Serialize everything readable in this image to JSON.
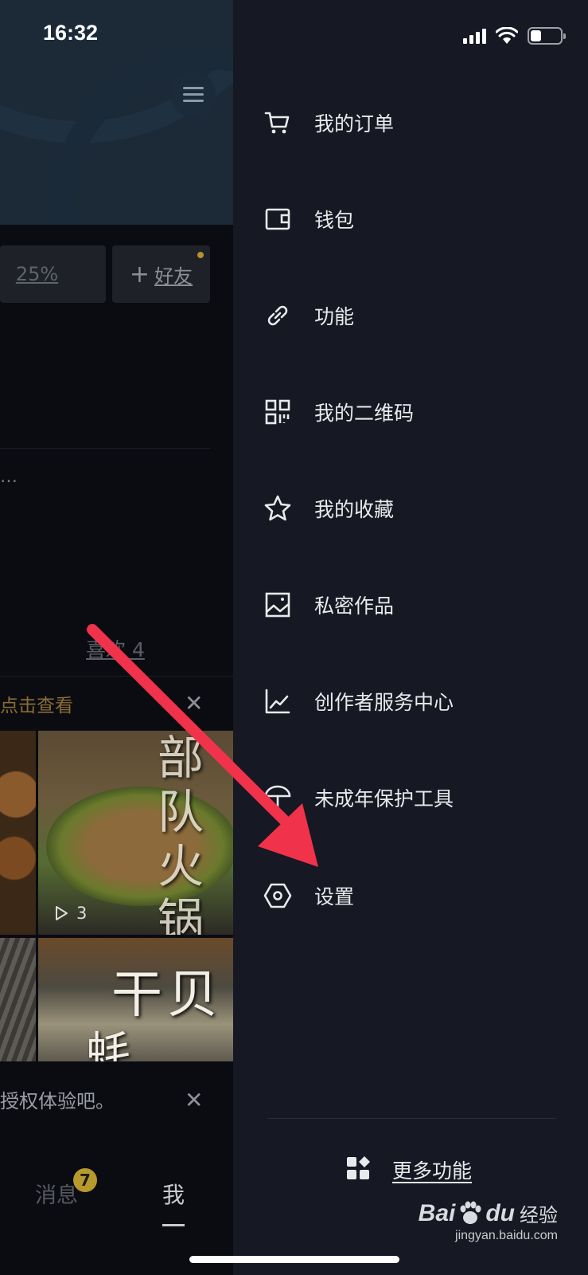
{
  "status_bar": {
    "time": "16:32",
    "battery_level": 0.35
  },
  "profile": {
    "stat_percent": "25%",
    "add_friend_plus": "+",
    "add_friend_label": "好友",
    "truncated_text": "…",
    "likes_label": "喜欢 4",
    "notice_text": "点击查看",
    "close_glyph": "✕",
    "thumb_title_1": "部队火锅",
    "thumb_title_2_line1": "干贝",
    "thumb_title_2_line2": "蚝",
    "play_count": "3",
    "auth_notice": "授权体验吧。"
  },
  "tabbar": {
    "messages_label": "消息",
    "messages_badge": "7",
    "me_label": "我"
  },
  "drawer": {
    "items": [
      {
        "label": "我的订单",
        "icon": "cart-icon"
      },
      {
        "label": "钱包",
        "icon": "wallet-icon"
      },
      {
        "label": "功能",
        "icon": "link-icon"
      },
      {
        "label": "我的二维码",
        "icon": "qrcode-icon"
      },
      {
        "label": "我的收藏",
        "icon": "star-icon"
      },
      {
        "label": "私密作品",
        "icon": "image-icon"
      },
      {
        "label": "创作者服务中心",
        "icon": "chart-icon"
      },
      {
        "label": "未成年保护工具",
        "icon": "umbrella-icon"
      },
      {
        "label": "设置",
        "icon": "settings-hexagon-icon"
      }
    ],
    "more_label": "更多功能"
  },
  "watermark": {
    "brand_left": "Bai",
    "brand_right": "du",
    "brand_cn": "经验",
    "url": "jingyan.baidu.com"
  },
  "colors": {
    "drawer_bg": "#161823",
    "arrow": "#f0324a",
    "accent_gold": "#b8912c"
  }
}
